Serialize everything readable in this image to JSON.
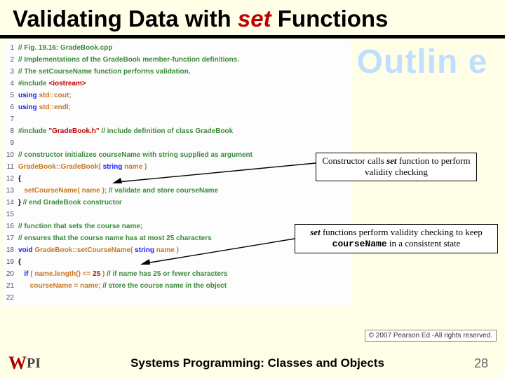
{
  "title_prefix": "Validating Data with ",
  "title_set": "set",
  "title_suffix": " Functions",
  "outline": "Outlin\ne",
  "code": [
    {
      "n": "1",
      "html": "<span class='c-comment'>// Fig. 19.16: GradeBook.cpp</span>"
    },
    {
      "n": "2",
      "html": "<span class='c-comment'>// Implementations of the GradeBook member-function definitions.</span>"
    },
    {
      "n": "3",
      "html": "<span class='c-comment'>// The setCourseName function performs validation.</span>"
    },
    {
      "n": "4",
      "html": "<span class='c-pp'>#include</span> <span class='c-str'>&lt;iostream&gt;</span>"
    },
    {
      "n": "5",
      "html": "<span class='c-kw'>using</span> <span class='c-cls'>std::cout;</span>"
    },
    {
      "n": "6",
      "html": "<span class='c-kw'>using</span> <span class='c-cls'>std::endl;</span>"
    },
    {
      "n": "7",
      "html": ""
    },
    {
      "n": "8",
      "html": "<span class='c-pp'>#include</span> <span class='c-str'>\"GradeBook.h\"</span> <span class='c-comment'>// include definition of class GradeBook</span>"
    },
    {
      "n": "9",
      "html": ""
    },
    {
      "n": "10",
      "html": "<span class='c-comment'>// constructor initializes courseName with string supplied as argument</span>"
    },
    {
      "n": "11",
      "html": "<span class='c-cls'>GradeBook::GradeBook(</span> <span class='c-kw'>string</span> <span class='c-cls'>name )</span>"
    },
    {
      "n": "12",
      "html": "<span class='c-plain'>{</span>"
    },
    {
      "n": "13",
      "html": "   <span class='c-cls'>setCourseName( name );</span> <span class='c-comment'>// validate and store courseName</span>"
    },
    {
      "n": "14",
      "html": "<span class='c-plain'>}</span> <span class='c-comment'>// end GradeBook constructor</span>"
    },
    {
      "n": "15",
      "html": ""
    },
    {
      "n": "16",
      "html": "<span class='c-comment'>// function that sets the course name;</span>"
    },
    {
      "n": "17",
      "html": "<span class='c-comment'>// ensures that the course name has at most 25 characters</span>"
    },
    {
      "n": "18",
      "html": "<span class='c-kw'>void</span> <span class='c-cls'>GradeBook::setCourseName(</span> <span class='c-kw'>string</span> <span class='c-cls'>name )</span>"
    },
    {
      "n": "19",
      "html": "<span class='c-plain'>{</span>"
    },
    {
      "n": "20",
      "html": "   <span class='c-kw'>if</span> <span class='c-cls'>( name.length() &lt;=</span> <span class='c-num'>25</span> <span class='c-cls'>)</span> <span class='c-comment'>// if name has 25 or fewer characters</span>"
    },
    {
      "n": "21",
      "html": "      <span class='c-cls'>courseName = name;</span> <span class='c-comment'>// store the course name in the object</span>"
    },
    {
      "n": "22",
      "html": ""
    }
  ],
  "callout1_a": "Constructor calls ",
  "callout1_set": "set",
  "callout1_b": " function to perform validity checking",
  "callout2_set": "set",
  "callout2_a": " functions perform validity checking to keep ",
  "callout2_mono": "courseName",
  "callout2_b": " in a consistent state",
  "copyright": "© 2007 Pearson Ed -All rights reserved.",
  "footer_title": "Systems Programming:   Classes and Objects",
  "page_number": "28",
  "logo_w": "W",
  "logo_pi": "PI"
}
